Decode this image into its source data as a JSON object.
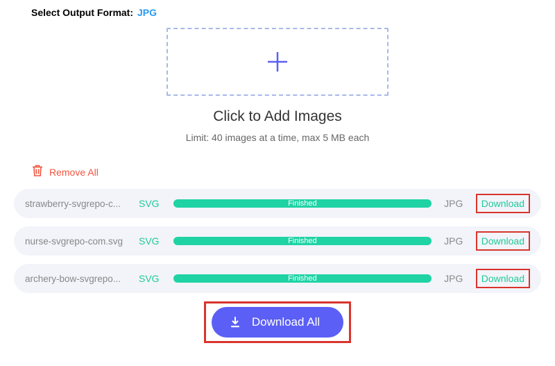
{
  "header": {
    "label": "Select Output Format:",
    "value": "JPG"
  },
  "dropzone": {
    "title": "Click to Add Images",
    "limit": "Limit: 40 images at a time, max 5 MB each"
  },
  "removeAll": "Remove All",
  "files": [
    {
      "name": "strawberry-svgrepo-c...",
      "from": "SVG",
      "status": "Finished",
      "to": "JPG",
      "action": "Download"
    },
    {
      "name": "nurse-svgrepo-com.svg",
      "from": "SVG",
      "status": "Finished",
      "to": "JPG",
      "action": "Download"
    },
    {
      "name": "archery-bow-svgrepo...",
      "from": "SVG",
      "status": "Finished",
      "to": "JPG",
      "action": "Download"
    }
  ],
  "downloadAll": "Download All"
}
